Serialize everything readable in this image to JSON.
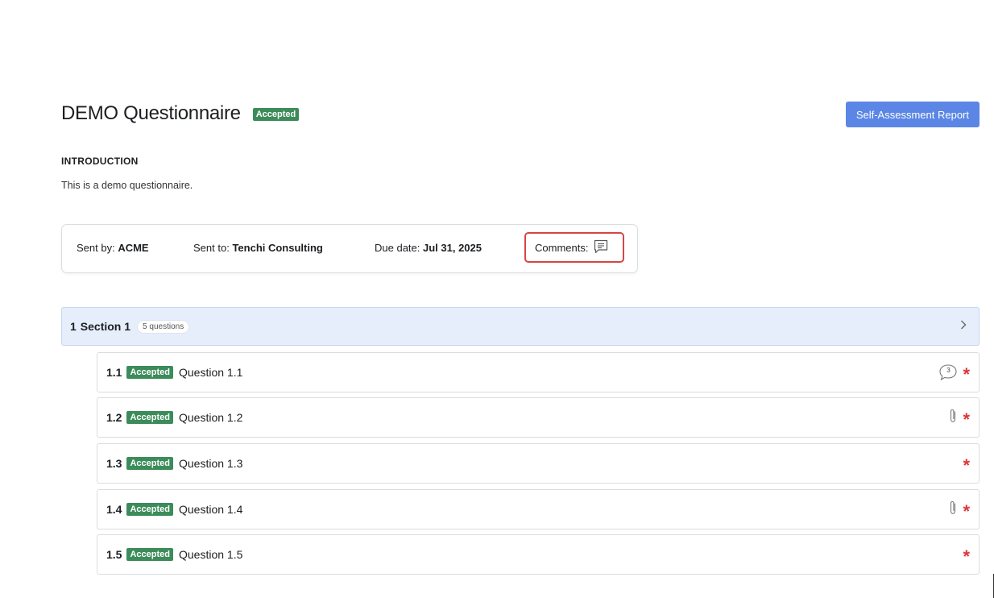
{
  "header": {
    "title": "DEMO Questionnaire",
    "status_badge": "Accepted",
    "report_button": "Self-Assessment Report"
  },
  "intro": {
    "heading": "INTRODUCTION",
    "text": "This is a demo questionnaire."
  },
  "info": {
    "sent_by_label": "Sent by:",
    "sent_by_value": "ACME",
    "sent_to_label": "Sent to:",
    "sent_to_value": "Tenchi Consulting",
    "due_label": "Due date:",
    "due_value": "Jul 31, 2025",
    "comments_label": "Comments:"
  },
  "section": {
    "number": "1",
    "name": "Section 1",
    "count": "5 questions"
  },
  "questions": [
    {
      "num": "1.1",
      "badge": "Accepted",
      "text": "Question 1.1",
      "comment_count": "3",
      "icons": [
        "comment-count-icon",
        "required-asterisk"
      ]
    },
    {
      "num": "1.2",
      "badge": "Accepted",
      "text": "Question 1.2",
      "icons": [
        "paperclip-icon",
        "required-asterisk"
      ]
    },
    {
      "num": "1.3",
      "badge": "Accepted",
      "text": "Question 1.3",
      "icons": [
        "required-asterisk"
      ]
    },
    {
      "num": "1.4",
      "badge": "Accepted",
      "text": "Question 1.4",
      "icons": [
        "paperclip-icon",
        "required-asterisk"
      ]
    },
    {
      "num": "1.5",
      "badge": "Accepted",
      "text": "Question 1.5",
      "icons": [
        "required-asterisk"
      ]
    }
  ],
  "required_mark": "*",
  "colors": {
    "accepted_badge": "#3c8c5a",
    "primary_button": "#5b86e5",
    "section_bg": "#e6eefc",
    "required": "#d93a3a",
    "highlight_border": "#d64545"
  }
}
